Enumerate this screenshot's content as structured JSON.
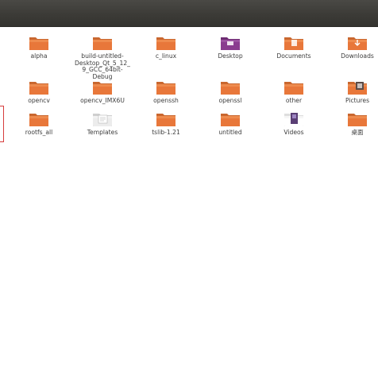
{
  "folders": [
    {
      "label": "alpha",
      "kind": "folder"
    },
    {
      "label": "build-untitled-Desktop_Qt_5_12_9_GCC_64bit-Debug",
      "kind": "folder"
    },
    {
      "label": "c_linux",
      "kind": "folder"
    },
    {
      "label": "Desktop",
      "kind": "desktop"
    },
    {
      "label": "Documents",
      "kind": "documents"
    },
    {
      "label": "Downloads",
      "kind": "downloads"
    },
    {
      "label": "opencv",
      "kind": "folder"
    },
    {
      "label": "opencv_IMX6U",
      "kind": "folder"
    },
    {
      "label": "openssh",
      "kind": "folder"
    },
    {
      "label": "openssl",
      "kind": "folder"
    },
    {
      "label": "other",
      "kind": "folder"
    },
    {
      "label": "Pictures",
      "kind": "pictures"
    },
    {
      "label": "rootfs_all",
      "kind": "folder"
    },
    {
      "label": "Templates",
      "kind": "templates"
    },
    {
      "label": "tslib-1.21",
      "kind": "folder"
    },
    {
      "label": "untitled",
      "kind": "folder"
    },
    {
      "label": "Videos",
      "kind": "videos"
    },
    {
      "label": "桌面",
      "kind": "folder"
    }
  ],
  "colors": {
    "folder": "#e8773a",
    "folder_tab": "#c9672f",
    "folder_light": "#f29a5c",
    "desktop": "#8a3c8f",
    "titlebar": "#3c3b37"
  }
}
